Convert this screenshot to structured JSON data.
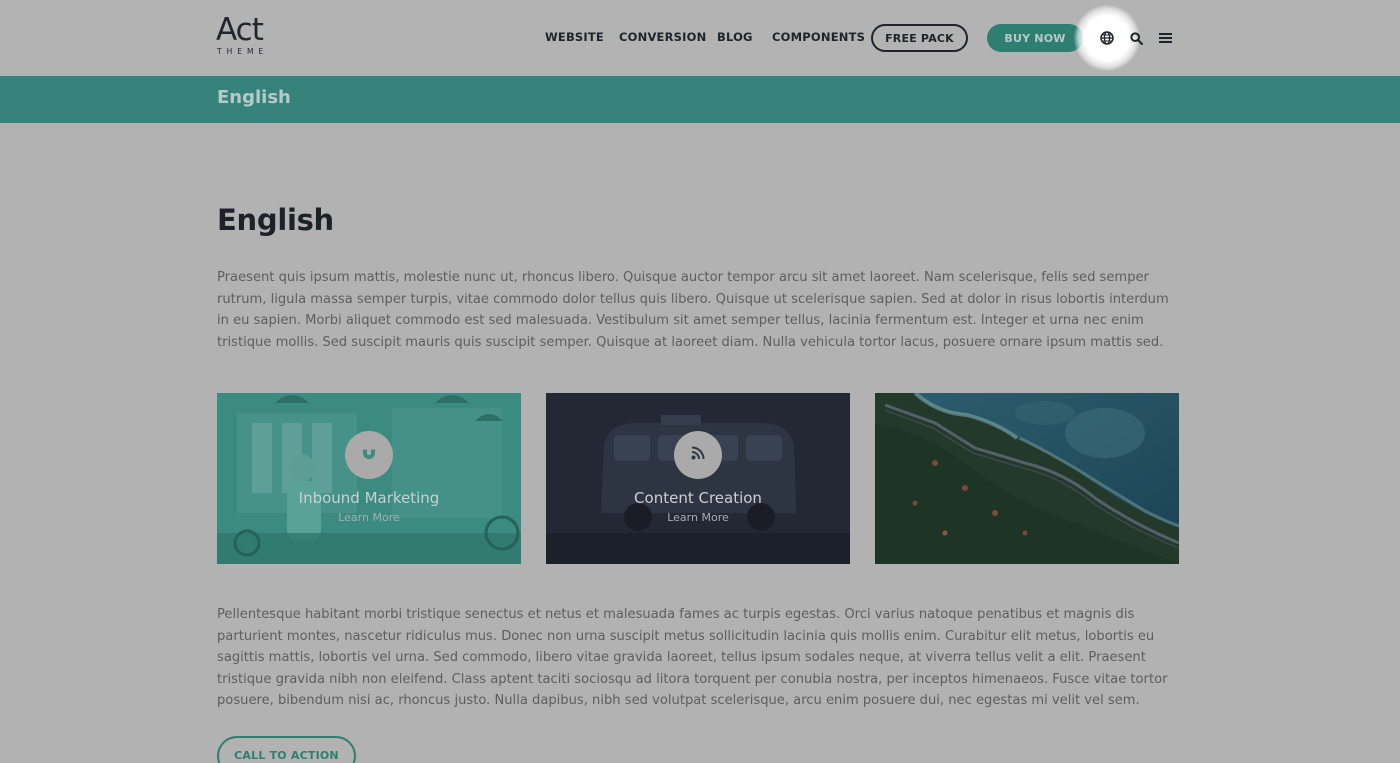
{
  "brand": {
    "logo_main": "Act",
    "logo_sub": "THEME"
  },
  "nav": {
    "links": [
      "WEBSITE",
      "CONVERSION",
      "BLOG",
      "COMPONENTS"
    ],
    "free_pack": "FREE PACK",
    "buy_now": "BUY NOW",
    "icons": [
      "globe-icon",
      "search-icon",
      "menu-icon"
    ]
  },
  "title_bar": {
    "text": "English"
  },
  "main": {
    "heading": "English",
    "paragraph1": "Praesent quis ipsum mattis, molestie nunc ut, rhoncus libero. Quisque auctor tempor arcu sit amet laoreet. Nam scelerisque, felis sed semper rutrum, ligula massa semper turpis, vitae commodo dolor tellus quis libero. Quisque ut scelerisque sapien. Sed at dolor in risus lobortis interdum in eu sapien. Morbi aliquet commodo est sed malesuada. Vestibulum sit amet semper tellus, lacinia fermentum est. Integer et urna nec enim tristique mollis. Sed suscipit mauris quis suscipit semper. Quisque at laoreet diam. Nulla vehicula tortor lacus, posuere ornare ipsum mattis sed.",
    "cards": [
      {
        "title": "Inbound Marketing",
        "link": "Learn More",
        "icon": "magnet-icon"
      },
      {
        "title": "Content Creation",
        "link": "Learn More",
        "icon": "rss-icon"
      },
      {
        "title": "",
        "link": "",
        "icon": ""
      }
    ],
    "paragraph2": "Pellentesque habitant morbi tristique senectus et netus et malesuada fames ac turpis egestas. Orci varius natoque penatibus et magnis dis parturient montes, nascetur ridiculus mus. Donec non urna suscipit metus sollicitudin lacinia quis mollis enim. Curabitur elit metus, lobortis eu sagittis mattis, lobortis vel urna. Sed commodo, libero vitae gravida laoreet, tellus ipsum sodales neque, at viverra tellus velit a elit. Praesent tristique gravida nibh non eleifend. Class aptent taciti sociosqu ad litora torquent per conubia nostra, per inceptos himenaeos. Fusce vitae tortor posuere, bibendum nisi ac, rhoncus justo. Nulla dapibus, nibh sed volutpat scelerisque, arcu enim posuere dui, nec egestas mi velit vel sem.",
    "cta": "CALL TO ACTION"
  },
  "colors": {
    "accent": "#2f7e72",
    "overlay_background": "#b2b2b2",
    "heading": "#1d212a"
  }
}
